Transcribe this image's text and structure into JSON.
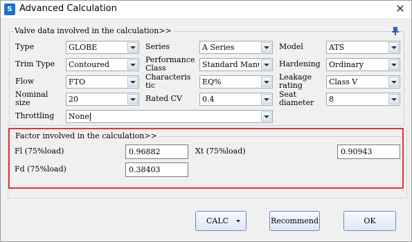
{
  "window": {
    "title": "Advanced Calculation",
    "app_icon_text": "S"
  },
  "valve_section": {
    "legend": "Valve data involved in the calculation>>",
    "fields": [
      {
        "label": "Type",
        "value": "GLOBE"
      },
      {
        "label": "Series",
        "value": "A Series"
      },
      {
        "label": "Model",
        "value": "ATS"
      },
      {
        "label": "Trim Type",
        "value": "Contoured"
      },
      {
        "label": "Performance Class",
        "value": "Standard Manuf"
      },
      {
        "label": "Hardening",
        "value": "Ordinary"
      },
      {
        "label": "Flow",
        "value": "FTO"
      },
      {
        "label": "Characteristic",
        "value": "EQ%"
      },
      {
        "label": "Leakage rating",
        "value": "Class V"
      },
      {
        "label": "Nominal size",
        "value": "20"
      },
      {
        "label": "Rated CV",
        "value": "0.4"
      },
      {
        "label": "Seat diameter",
        "value": "8"
      },
      {
        "label": "Throttling",
        "value": "None"
      }
    ],
    "label_lines": {
      "performance": [
        "Performance",
        "Class"
      ],
      "characteristic": [
        "Characteris",
        "tic"
      ],
      "leakage": [
        "Leakage",
        "rating"
      ],
      "nominal": [
        "Nominal",
        "size"
      ],
      "seat": [
        "Seat",
        "diameter"
      ]
    }
  },
  "factor_section": {
    "legend": "Factor  involved in the calculation>>",
    "fl_label": "Fl (75%load)",
    "fl_value": "0.96882",
    "xt_label": "Xt (75%load)",
    "xt_value": "0.90943",
    "fd_label": "Fd (75%load)",
    "fd_value": "0.38403"
  },
  "buttons": {
    "calc": "CALC",
    "recommend": "Recommend",
    "ok": "OK"
  },
  "colors": {
    "highlight": "#e03535",
    "button_border": "#6f86b5"
  }
}
